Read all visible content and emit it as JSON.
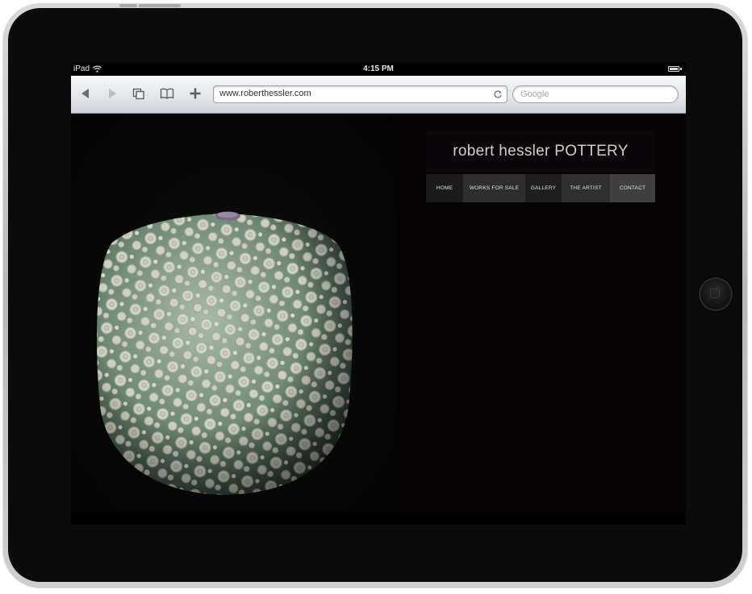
{
  "status_bar": {
    "carrier": "iPad",
    "time": "4:15 PM"
  },
  "browser": {
    "url": "www.roberthessler.com",
    "search_placeholder": "Google",
    "toolbar_icons": [
      "back-arrow-icon",
      "forward-arrow-icon",
      "pages-icon",
      "bookmarks-icon",
      "add-icon",
      "reload-icon"
    ]
  },
  "site": {
    "title": "robert hessler POTTERY",
    "nav": [
      {
        "label": "HOME"
      },
      {
        "label": "WORKS FOR SALE"
      },
      {
        "label": "GALLERY"
      },
      {
        "label": "THE ARTIST"
      },
      {
        "label": "CONTACT"
      }
    ]
  },
  "colors": {
    "page_background": "#060305",
    "nav_home": "#1b1b1b",
    "nav_works": "#2e2e2e",
    "nav_gallery": "#1f1f1f",
    "nav_artist": "#2f2f2f",
    "nav_contact": "#404040",
    "vase_green": "#6f8a76",
    "vase_cream": "#d9d7c6"
  }
}
